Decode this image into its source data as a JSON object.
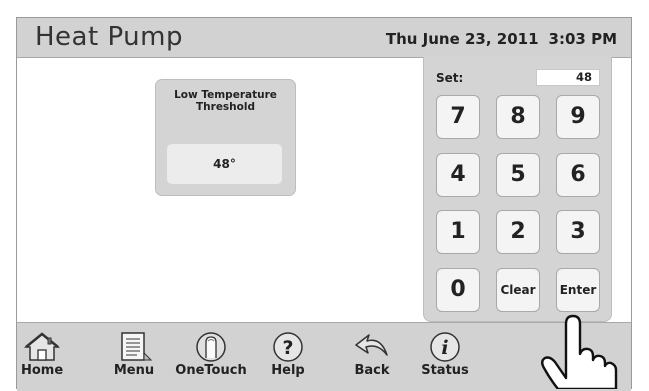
{
  "header": {
    "title": "Heat Pump",
    "date": "Thu June 23, 2011",
    "time": "3:03 PM"
  },
  "card": {
    "title_line1": "Low Temperature",
    "title_line2": "Threshold",
    "value": "48°"
  },
  "keypad": {
    "set_label": "Set:",
    "set_value": "48",
    "keys": [
      "7",
      "8",
      "9",
      "4",
      "5",
      "6",
      "1",
      "2",
      "3",
      "0",
      "Clear",
      "Enter"
    ]
  },
  "toolbar": {
    "items": [
      {
        "label": "Home",
        "icon": "home-icon"
      },
      {
        "label": "Menu",
        "icon": "menu-icon"
      },
      {
        "label": "OneTouch",
        "icon": "onetouch-icon"
      },
      {
        "label": "Help",
        "icon": "help-icon"
      },
      {
        "label": "Back",
        "icon": "back-icon"
      },
      {
        "label": "Status",
        "icon": "status-icon"
      }
    ]
  }
}
